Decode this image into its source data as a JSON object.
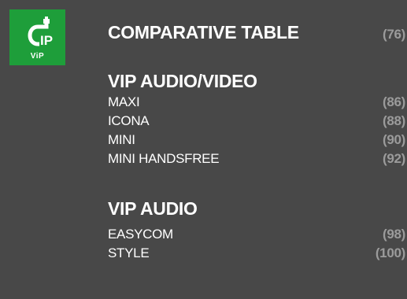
{
  "badge": {
    "icon": "ip-cable-icon",
    "code": "IP",
    "label": "ViP",
    "color": "#1e9e3a"
  },
  "toc": {
    "top_entry": {
      "label": "COMPARATIVE TABLE",
      "page": "(76)"
    },
    "sections": [
      {
        "title": "VIP AUDIO/VIDEO",
        "items": [
          {
            "label": "MAXI",
            "page": "(86)"
          },
          {
            "label": "ICONA",
            "page": "(88)"
          },
          {
            "label": "MINI",
            "page": "(90)"
          },
          {
            "label": "MINI HANDSFREE",
            "page": "(92)"
          }
        ]
      },
      {
        "title": "VIP AUDIO",
        "items": [
          {
            "label": "EASYCOM",
            "page": "(98)"
          },
          {
            "label": "STYLE",
            "page": "(100)"
          }
        ]
      }
    ]
  },
  "colors": {
    "background": "#484848",
    "text": "#ffffff",
    "page_number": "#9b9b9b"
  }
}
